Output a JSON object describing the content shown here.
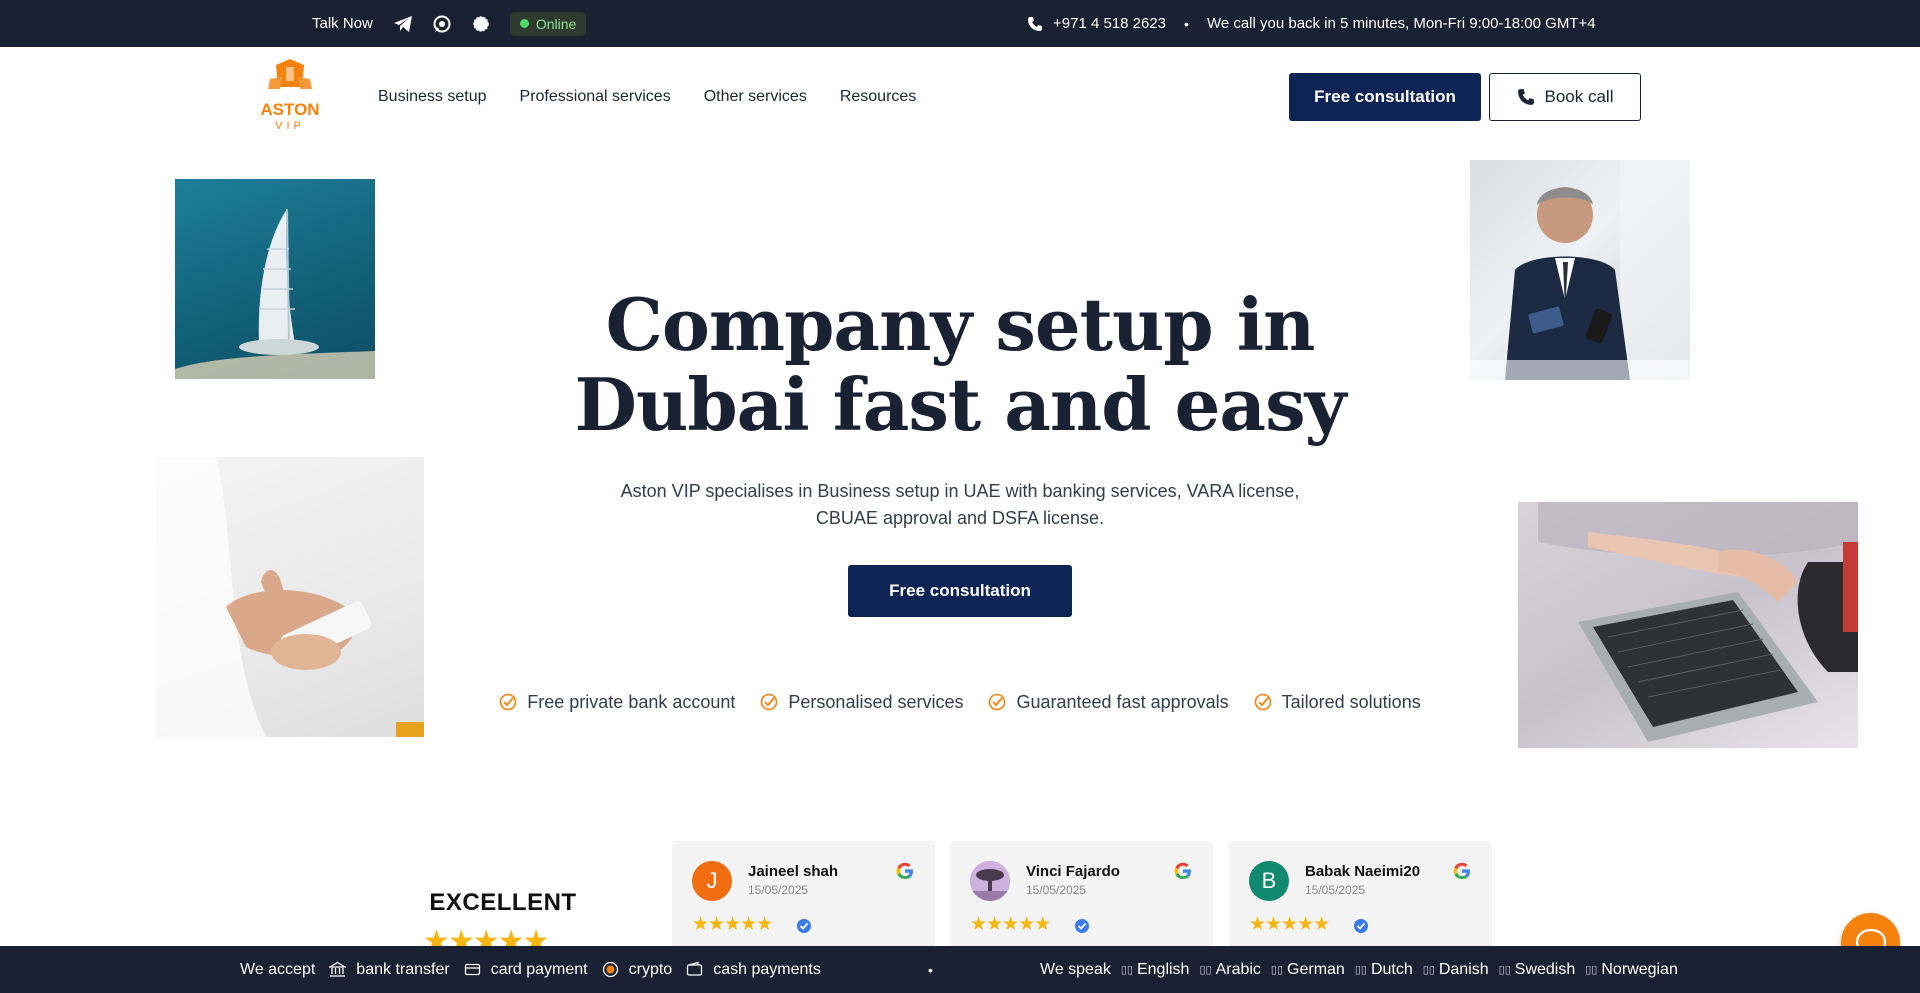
{
  "topbar": {
    "talk_now": "Talk Now",
    "online": "Online",
    "phone": "+971 4 518 2623",
    "bullet": "•",
    "callback": "We call you back in 5 minutes, Mon-Fri 9:00-18:00 GMT+4"
  },
  "header": {
    "logo_text": "ASTON",
    "logo_sub": "VIP",
    "nav": [
      "Business setup",
      "Professional services",
      "Other services",
      "Resources"
    ],
    "free_consultation": "Free consultation",
    "book_call": "Book call"
  },
  "hero": {
    "title_line1": "Company setup in",
    "title_line2": "Dubai fast and easy",
    "subtitle_line1": "Aston VIP specialises in Business setup in UAE with banking services, VARA license,",
    "subtitle_line2": "CBUAE approval and DSFA license.",
    "cta": "Free consultation",
    "features": [
      "Free private bank account",
      "Personalised services",
      "Guaranteed fast approvals",
      "Tailored solutions"
    ]
  },
  "reviews": {
    "rating_label": "EXCELLENT",
    "stars": "★★★★★",
    "items": [
      {
        "initial": "J",
        "name": "Jaineel shah",
        "date": "15/05/2025",
        "stars": "★★★★★",
        "avatar_color": "#f06d10"
      },
      {
        "initial": "",
        "name": "Vinci Fajardo",
        "date": "15/05/2025",
        "stars": "★★★★★",
        "avatar_color": "#c9a8d8"
      },
      {
        "initial": "B",
        "name": "Babak Naeimi20",
        "date": "15/05/2025",
        "stars": "★★★★★",
        "avatar_color": "#0f8a6e"
      }
    ]
  },
  "bottombar": {
    "we_accept": "We accept",
    "payments": [
      "bank transfer",
      "card payment",
      "crypto",
      "cash payments"
    ],
    "bullet": "•",
    "we_speak": "We speak",
    "languages": [
      "English",
      "Arabic",
      "German",
      "Dutch",
      "Danish",
      "Swedish",
      "Norwegian"
    ]
  },
  "colors": {
    "navy": "#0d2454",
    "dark_bar": "#1a2132",
    "accent_orange": "#f5820c",
    "star_gold": "#f6b60f"
  }
}
